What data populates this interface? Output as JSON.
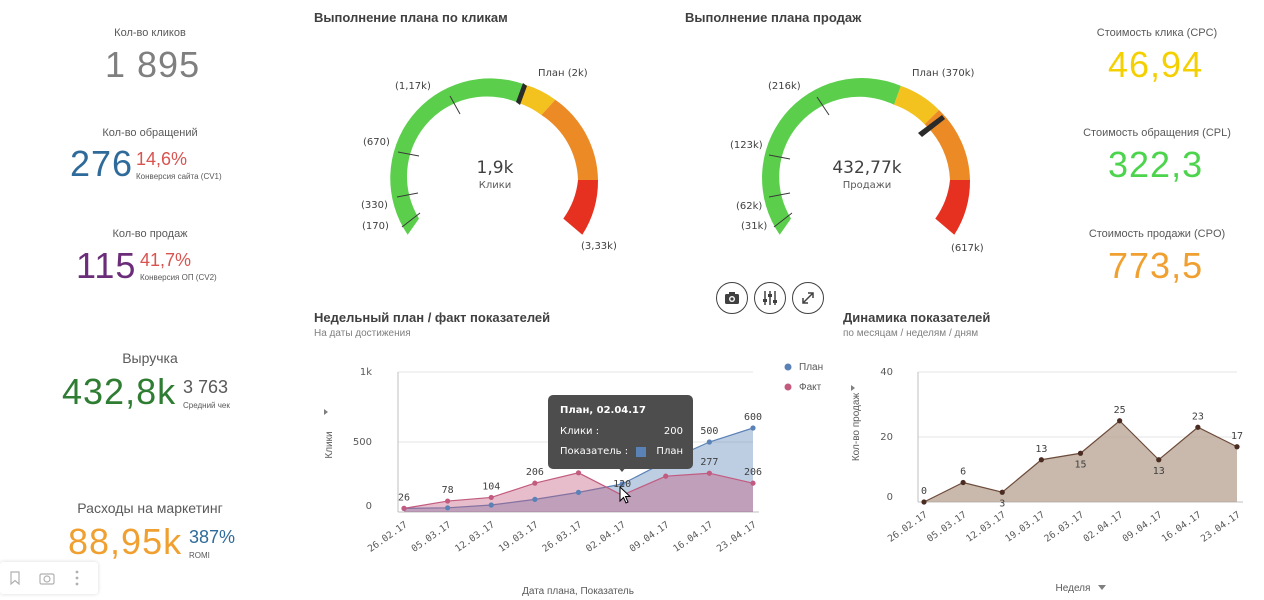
{
  "left_kpis": {
    "clicks": {
      "label": "Кол-во кликов",
      "value": "1 895",
      "color": "#7f7f7f"
    },
    "leads": {
      "label": "Кол-во обращений",
      "value": "276",
      "pct": "14,6%",
      "pct_label": "Конверсия сайта (CV1)",
      "color": "#2f6b9a",
      "pct_color": "#d9534f"
    },
    "sales": {
      "label": "Кол-во продаж",
      "value": "115",
      "pct": "41,7%",
      "pct_label": "Конверсия ОП (CV2)",
      "color": "#6b2c7a",
      "pct_color": "#d9534f"
    },
    "revenue": {
      "label": "Выручка",
      "value": "432,8k",
      "sub_value": "3 763",
      "sub_label": "Средний чек",
      "color": "#2e7d32"
    },
    "marketing": {
      "label": "Расходы на маркетинг",
      "value": "88,95k",
      "sub_value": "387%",
      "sub_label": "ROMI",
      "color": "#f0a030",
      "sub_color": "#2f6b9a"
    }
  },
  "right_kpis": {
    "cpc": {
      "label": "Стоимость клика (CPC)",
      "value": "46,94",
      "color": "#f5d000"
    },
    "cpl": {
      "label": "Стоимость обращения (CPL)",
      "value": "322,3",
      "color": "#4cd44c"
    },
    "cpo": {
      "label": "Стоимость продажи (CPO)",
      "value": "773,5",
      "color": "#f0a030"
    }
  },
  "gauge_clicks": {
    "title": "Выполнение плана по кликам",
    "center_value": "1,9k",
    "center_label": "Клики",
    "plan_label": "План (2k)",
    "ticks": [
      "(170)",
      "(330)",
      "(670)",
      "(1,17k)"
    ],
    "max_label": "(3,33k)",
    "value": 1895,
    "max": 3330,
    "plan": 2000
  },
  "gauge_sales": {
    "title": "Выполнение плана продаж",
    "center_value": "432,77k",
    "center_label": "Продажи",
    "plan_label": "План (370k)",
    "ticks": [
      "(31k)",
      "(62k)",
      "(123k)",
      "(216k)"
    ],
    "max_label": "(617k)",
    "value": 432770,
    "max": 617000,
    "plan": 370000
  },
  "toolbar": {
    "camera": "camera-icon",
    "adjust": "sliders-icon",
    "expand": "expand-icon"
  },
  "weekly_chart": {
    "title": "Недельный план / факт показателей",
    "subtitle": "На даты достижения",
    "ylabel": "Клики",
    "xlabel": "Дата плана, Показатель",
    "legend_plan": "План",
    "legend_fact": "Факт",
    "y_ticks": [
      "0",
      "500",
      "1k"
    ]
  },
  "dynamics_chart": {
    "title": "Динамика показателей",
    "subtitle": "по месяцам / неделям / дням",
    "ylabel": "Кол-во продаж",
    "xlabel": "Неделя",
    "y_ticks": [
      "0",
      "20",
      "40"
    ]
  },
  "tooltip": {
    "title": "План, 02.04.17",
    "row1_label": "Клики :",
    "row1_value": "200",
    "row2_label": "Показатель :",
    "row2_value": "План"
  },
  "chart_data": [
    {
      "type": "area",
      "title": "Недельный план / факт показателей",
      "xlabel": "Дата плана, Показатель",
      "ylabel": "Клики",
      "ylim": [
        0,
        1000
      ],
      "categories": [
        "26.02.17",
        "05.03.17",
        "12.03.17",
        "19.03.17",
        "26.03.17",
        "02.04.17",
        "09.04.17",
        "16.04.17",
        "23.04.17"
      ],
      "series": [
        {
          "name": "План",
          "color": "#5b82b7",
          "values": [
            26,
            30,
            50,
            90,
            140,
            200,
            360,
            500,
            600
          ]
        },
        {
          "name": "Факт",
          "color": "#c25b7f",
          "values": [
            26,
            78,
            104,
            206,
            280,
            120,
            256,
            277,
            206
          ]
        }
      ],
      "labels": [
        {
          "series": "План",
          "index": 0,
          "text": "26"
        },
        {
          "series": "Факт",
          "index": 1,
          "text": "78"
        },
        {
          "series": "Факт",
          "index": 2,
          "text": "104"
        },
        {
          "series": "Факт",
          "index": 3,
          "text": "206"
        },
        {
          "series": "Факт",
          "index": 5,
          "text": "120"
        },
        {
          "series": "Факт",
          "index": 6,
          "text": "256"
        },
        {
          "series": "Факт",
          "index": 7,
          "text": "277"
        },
        {
          "series": "Факт",
          "index": 8,
          "text": "206"
        },
        {
          "series": "План",
          "index": 7,
          "text": "500"
        },
        {
          "series": "План",
          "index": 8,
          "text": "600"
        }
      ],
      "legend": "top-right",
      "grid": true
    },
    {
      "type": "area",
      "title": "Динамика показателей",
      "xlabel": "Неделя",
      "ylabel": "Кол-во продаж",
      "ylim": [
        0,
        40
      ],
      "categories": [
        "26.02.17",
        "05.03.17",
        "12.03.17",
        "19.03.17",
        "26.03.17",
        "02.04.17",
        "09.04.17",
        "16.04.17",
        "23.04.17"
      ],
      "series": [
        {
          "color": "#b5a190",
          "values": [
            0,
            6,
            3,
            13,
            15,
            25,
            13,
            23,
            17
          ]
        }
      ],
      "grid": true
    }
  ]
}
